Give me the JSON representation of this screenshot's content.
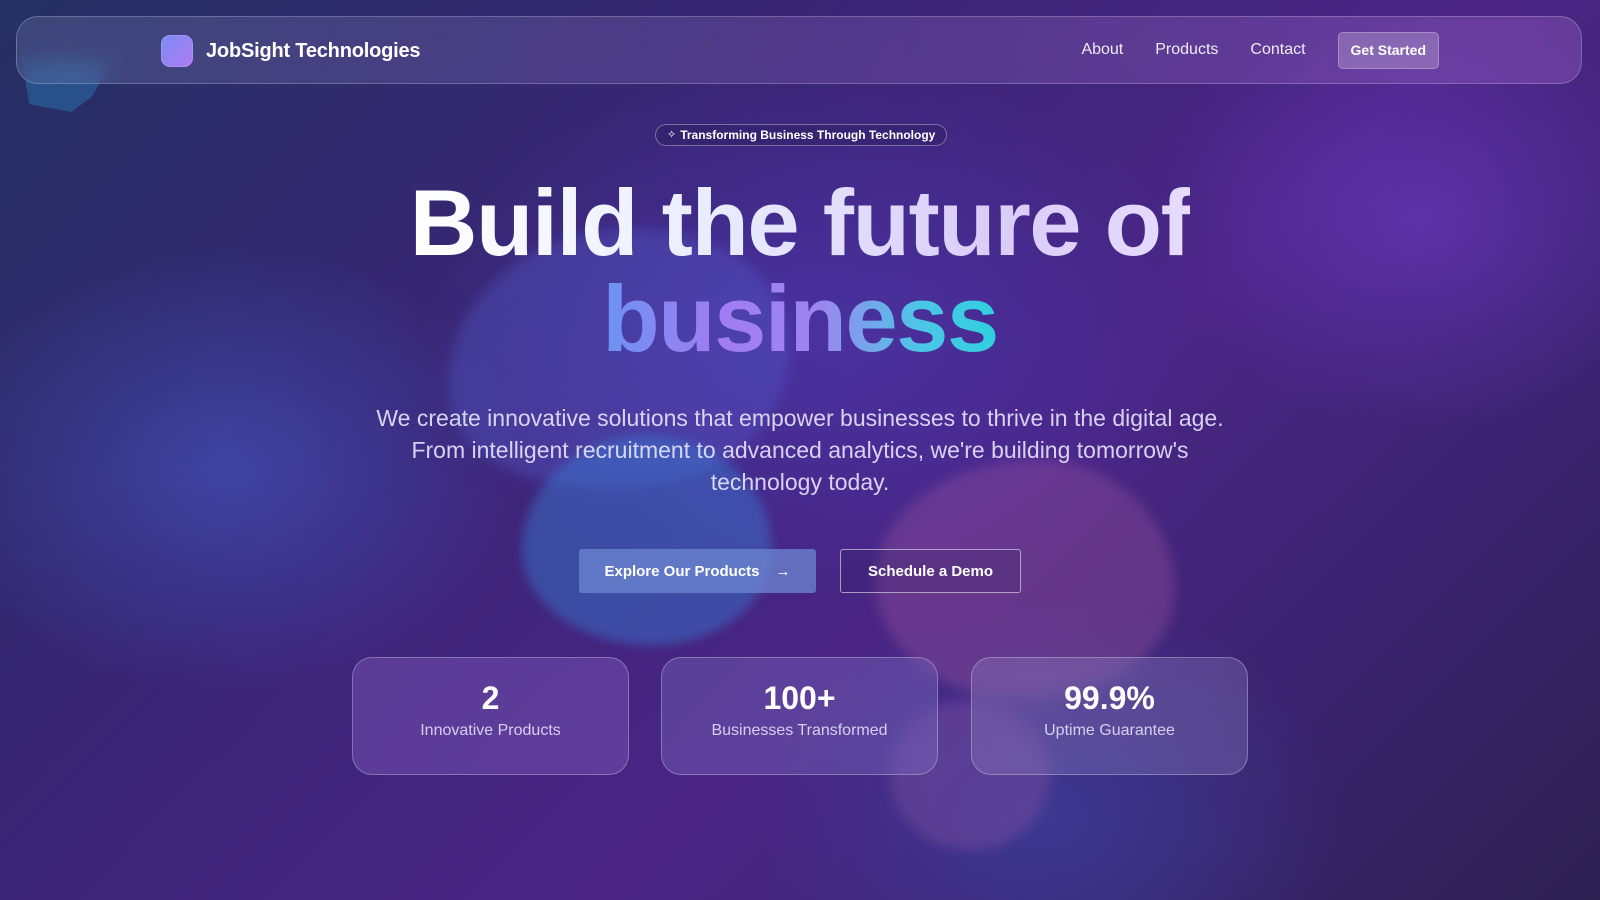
{
  "colors": {
    "accent": "#7b8cf5",
    "gradient_start": "#6a93f2",
    "gradient_end": "#2fd0e0",
    "background": "#3a2576"
  },
  "nav": {
    "brand_name": "JobSight Technologies",
    "brand_icon": "gradient-square-logo",
    "links": [
      "About",
      "Products",
      "Contact"
    ],
    "cta_label": "Get Started"
  },
  "badge": {
    "icon": "sparkle-icon",
    "text": "Transforming Business Through Technology"
  },
  "hero": {
    "title_line1": "Build the future of",
    "title_line2": "business",
    "subtitle": "We create innovative solutions that empower businesses to thrive in the digital age. From intelligent recruitment to advanced analytics, we're building tomorrow's technology today."
  },
  "cta": {
    "primary_label": "Explore Our Products",
    "primary_icon": "arrow-right-icon",
    "secondary_label": "Schedule a Demo"
  },
  "stats": [
    {
      "value": "2",
      "label": "Innovative Products"
    },
    {
      "value": "100+",
      "label": "Businesses Transformed"
    },
    {
      "value": "99.9%",
      "label": "Uptime Guarantee"
    }
  ]
}
